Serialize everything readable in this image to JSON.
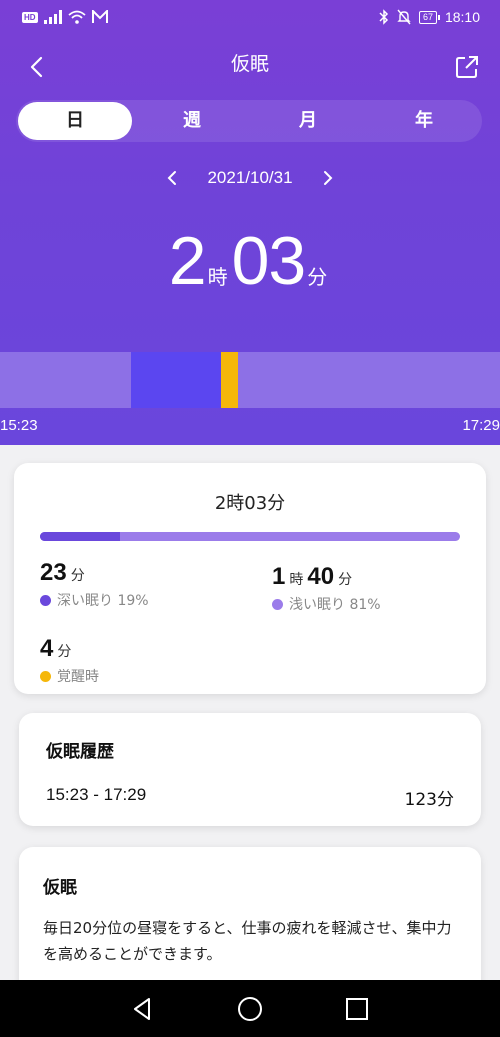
{
  "statusbar": {
    "network": "HD",
    "battery": "67",
    "time": "18:10"
  },
  "header": {
    "title": "仮眠"
  },
  "tabs": [
    {
      "label": "日",
      "active": true
    },
    {
      "label": "週",
      "active": false
    },
    {
      "label": "月",
      "active": false
    },
    {
      "label": "年",
      "active": false
    }
  ],
  "date": "2021/10/31",
  "duration": {
    "hours": "2",
    "hour_unit": "時",
    "minutes": "03",
    "minute_unit": "分"
  },
  "timeline": {
    "start": "15:23",
    "end": "17:29",
    "segments": [
      {
        "type": "light",
        "start_fraction": 0.0,
        "end_fraction": 0.262
      },
      {
        "type": "deep",
        "start_fraction": 0.262,
        "end_fraction": 0.442
      },
      {
        "type": "awake",
        "start_fraction": 0.442,
        "end_fraction": 0.476
      },
      {
        "type": "light",
        "start_fraction": 0.476,
        "end_fraction": 1.0
      }
    ]
  },
  "summary": {
    "total": "2時03分",
    "deep_fraction": 0.19,
    "deep": {
      "value": "23",
      "unit": "分",
      "label": "深い眠り 19%"
    },
    "light": {
      "hours": "1",
      "hour_unit": "時",
      "minutes": "40",
      "minute_unit": "分",
      "label": "浅い眠り 81%"
    },
    "awake": {
      "value": "4",
      "unit": "分",
      "label": "覚醒時"
    }
  },
  "history": {
    "title": "仮眠履歴",
    "range": "15:23 - 17:29",
    "minutes": "123分"
  },
  "info": {
    "title": "仮眠",
    "description": "毎日20分位の昼寝をすると、仕事の疲れを軽減させ、集中力を高めることができます。"
  },
  "colors": {
    "deep": "#6a48dc",
    "light": "#9b7cea",
    "awake": "#f5b70a",
    "timeline_deep": "#5b46f0",
    "timeline_light": "#8d70e6"
  }
}
